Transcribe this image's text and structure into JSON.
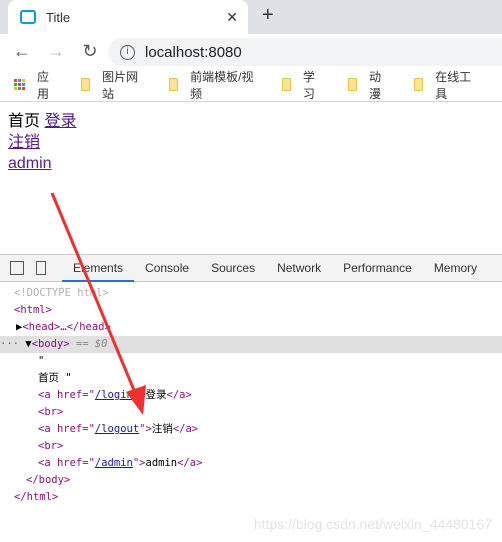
{
  "browser": {
    "tab_title": "Title",
    "url": "localhost:8080",
    "bookmarks": [
      "应用",
      "图片网站",
      "前端模板/视频",
      "学习",
      "动漫",
      "在线工具"
    ]
  },
  "page": {
    "home_text": "首页",
    "login_link": "登录",
    "logout_link": "注销",
    "admin_link": "admin"
  },
  "devtools": {
    "tabs": [
      "Elements",
      "Console",
      "Sources",
      "Network",
      "Performance",
      "Memory"
    ],
    "lines": {
      "doctype": "<!DOCTYPE html>",
      "html_open": "<html>",
      "head": "<head>…</head>",
      "body": "<body>",
      "body_sel": " == $0",
      "quote": "\"",
      "home": "首页 \"",
      "a_open": "<a href=\"",
      "login_href": "/login",
      "login_text": "登录",
      "br": "<br>",
      "logout_href": "/logout",
      "logout_text": "注销",
      "admin_href": "/admin",
      "admin_text": "admin",
      "a_close": "</a>",
      "body_close": "</body>",
      "html_close": "</html>",
      "q_close": "\">"
    }
  },
  "watermark": "https://blog.csdn.net/weixin_44480167",
  "colors": {
    "annotation_arrow": "#f03030",
    "active_tab": "#1a73e8"
  }
}
